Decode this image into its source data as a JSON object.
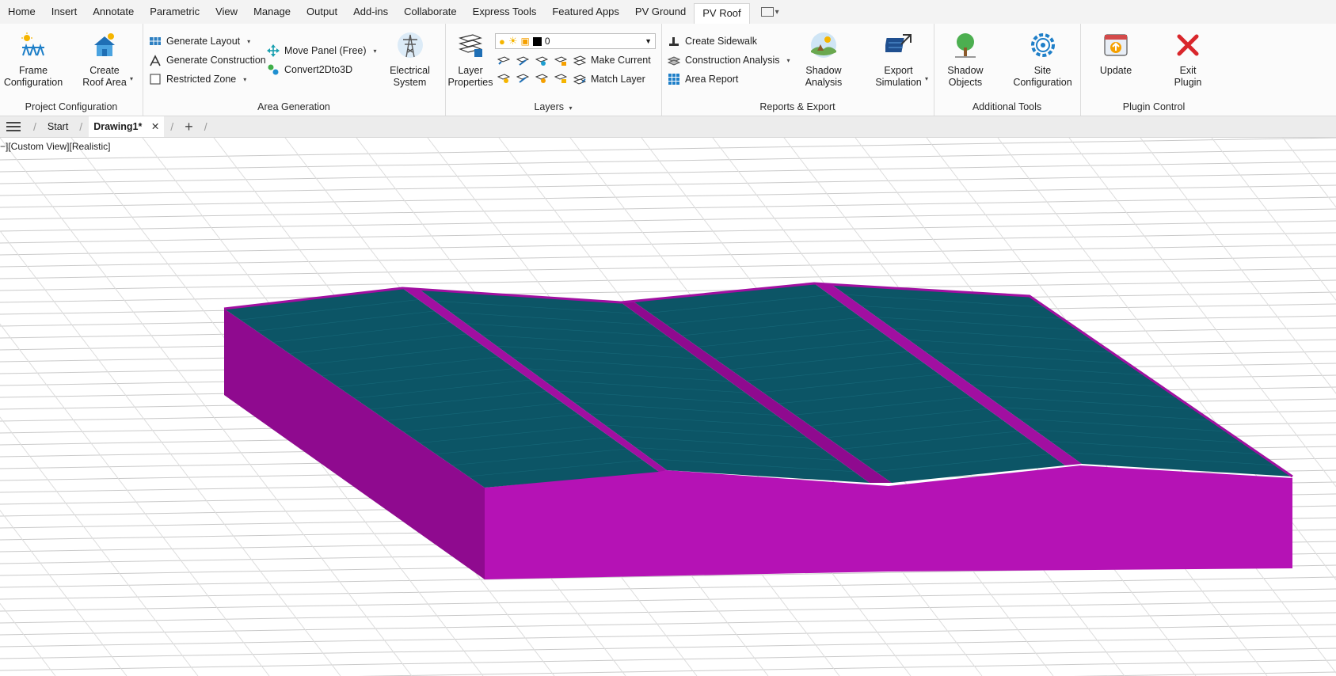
{
  "menu": {
    "tabs": [
      "Home",
      "Insert",
      "Annotate",
      "Parametric",
      "View",
      "Manage",
      "Output",
      "Add-ins",
      "Collaborate",
      "Express Tools",
      "Featured Apps",
      "PV Ground",
      "PV Roof"
    ],
    "active": "PV Roof"
  },
  "ribbon": {
    "project_configuration": {
      "title": "Project Configuration",
      "frame_configuration": "Frame\nConfiguration",
      "create_roof_area": "Create\nRoof Area"
    },
    "area_generation": {
      "title": "Area Generation",
      "generate_layout": "Generate Layout",
      "generate_construction": "Generate Construction",
      "restricted_zone": "Restricted Zone",
      "move_panel": "Move Panel (Free)",
      "convert": "Convert2Dto3D",
      "electrical_system": "Electrical\nSystem"
    },
    "layers": {
      "title": "Layers",
      "layer_properties": "Layer\nProperties",
      "current_layer": "0",
      "make_current": "Make Current",
      "match_layer": "Match Layer"
    },
    "reports_export": {
      "title": "Reports & Export",
      "create_sidewalk": "Create Sidewalk",
      "construction_analysis": "Construction Analysis",
      "area_report": "Area Report",
      "shadow_analysis": "Shadow\nAnalysis",
      "export_simulation": "Export\nSimulation"
    },
    "additional_tools": {
      "title": "Additional Tools",
      "shadow_objects": "Shadow\nObjects",
      "site_configuration": "Site\nConfiguration"
    },
    "plugin_control": {
      "title": "Plugin Control",
      "update": "Update",
      "exit_plugin": "Exit\nPlugin"
    }
  },
  "doc_tabs": {
    "start": "Start",
    "drawing": "Drawing1*"
  },
  "viewport": {
    "label": "−][Custom View][Realistic]"
  },
  "colors": {
    "roof_side": "#b512b5",
    "roof_side_dark": "#8f0a8f",
    "panel": "#0c5566",
    "ridge": "#a10fa1"
  }
}
